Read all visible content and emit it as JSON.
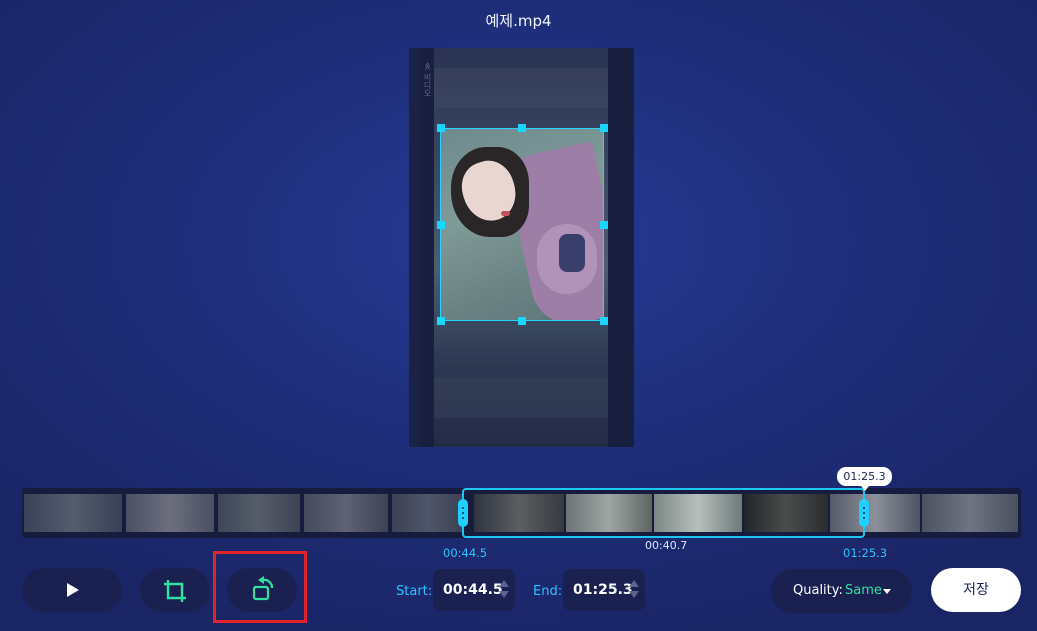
{
  "title": "예제.mp4",
  "preview": {
    "side_text": "≪ 비디오"
  },
  "timeline": {
    "tooltip": "01:25.3",
    "start_label": "00:44.5",
    "duration_label": "00:40.7",
    "end_label": "01:25.3"
  },
  "controls": {
    "start_label": "Start:",
    "start_value": "00:44.5",
    "end_label": "End:",
    "end_value": "01:25.3",
    "quality_label": "Quality:",
    "quality_value": "Same",
    "save_label": "저장"
  },
  "icons": {
    "play": "play-icon",
    "crop": "crop-icon",
    "rotate": "rotate-icon"
  },
  "colors": {
    "accent_cyan": "#1fc6f0",
    "accent_green": "#31e0a0",
    "highlight_red": "#e0242b"
  }
}
